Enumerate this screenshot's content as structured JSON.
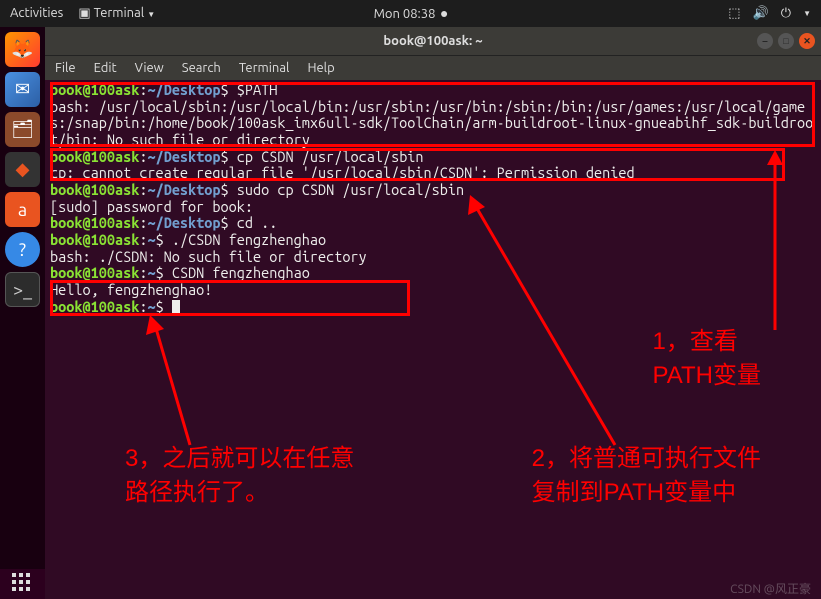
{
  "topbar": {
    "activities": "Activities",
    "app": "Terminal",
    "time": "Mon 08:38"
  },
  "window": {
    "title": "book@100ask: ~"
  },
  "menu": [
    "File",
    "Edit",
    "View",
    "Search",
    "Terminal",
    "Help"
  ],
  "prompt": {
    "user_host": "book@100ask",
    "sep": ":",
    "desktop": "~/Desktop",
    "home": "~",
    "sym": "$"
  },
  "lines": {
    "cmd1": " $PATH",
    "out1": "bash: /usr/local/sbin:/usr/local/bin:/usr/sbin:/usr/bin:/sbin:/bin:/usr/games:/usr/local/games:/snap/bin:/home/book/100ask_imx6ull-sdk/ToolChain/arm-buildroot-linux-gnueabihf_sdk-buildroot/bin: No such file or directory",
    "cmd2": " cp CSDN /usr/local/sbin",
    "out2": "cp: cannot create regular file '/usr/local/sbin/CSDN': Permission denied",
    "cmd3": " sudo cp CSDN /usr/local/sbin",
    "out3": "[sudo] password for book:",
    "cmd4": " cd ..",
    "cmd5": " ./CSDN fengzhenghao",
    "out5": "bash: ./CSDN: No such file or directory",
    "cmd6": " CSDN fengzhenghao",
    "out6": "Hello, fengzhenghao!",
    "cmd7": " "
  },
  "annotations": {
    "a1_line1": "1，查看",
    "a1_line2": "PATH变量",
    "a2_line1": "2，将普通可执行文件",
    "a2_line2": "复制到PATH变量中",
    "a3_line1": "3，之后就可以在任意",
    "a3_line2": "路径执行了。"
  },
  "watermark": "CSDN @风正豪"
}
